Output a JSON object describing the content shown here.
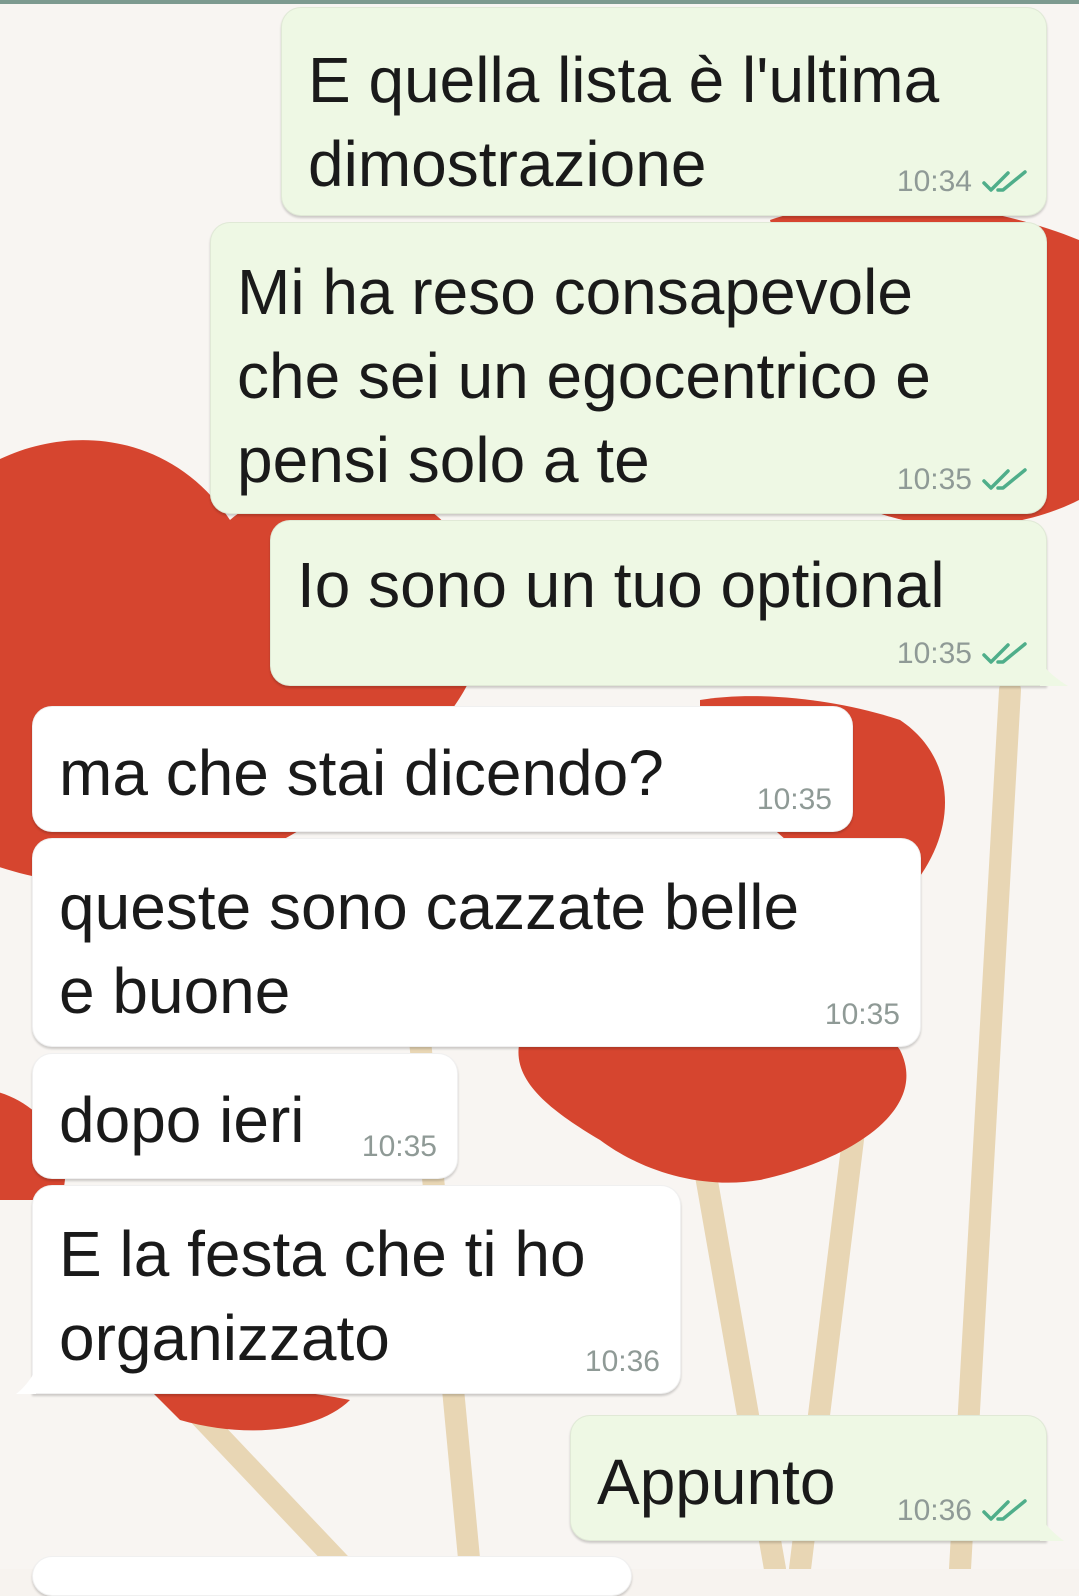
{
  "chat": {
    "messages": [
      {
        "direction": "outgoing",
        "lines": [
          "E quella lista è l'ultima",
          "dimostrazione"
        ],
        "time": "10:34",
        "status_icon": "double-check-icon"
      },
      {
        "direction": "outgoing",
        "lines": [
          "Mi ha reso consapevole",
          "che sei un egocentrico e",
          "pensi solo a te"
        ],
        "time": "10:35",
        "status_icon": "double-check-icon"
      },
      {
        "direction": "outgoing",
        "lines": [
          "Io sono un tuo optional"
        ],
        "time": "10:35",
        "status_icon": "double-check-icon"
      },
      {
        "direction": "incoming",
        "lines": [
          "ma che stai dicendo?"
        ],
        "time": "10:35"
      },
      {
        "direction": "incoming",
        "lines": [
          "queste sono cazzate belle",
          "e buone"
        ],
        "time": "10:35"
      },
      {
        "direction": "incoming",
        "lines": [
          "dopo ieri"
        ],
        "time": "10:35"
      },
      {
        "direction": "incoming",
        "lines": [
          "E la festa che ti ho",
          "organizzato"
        ],
        "time": "10:36"
      },
      {
        "direction": "outgoing",
        "lines": [
          "Appunto"
        ],
        "time": "10:36",
        "status_icon": "double-check-icon"
      }
    ]
  },
  "colors": {
    "outgoing_bubble": "#eef8e4",
    "incoming_bubble": "#ffffff",
    "read_ticks": "#4fae8a",
    "wallpaper_hearts": "#d6452f"
  }
}
